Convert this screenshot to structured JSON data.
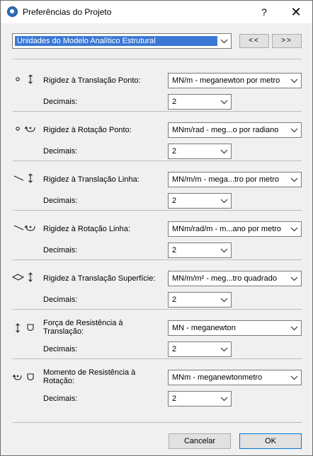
{
  "window": {
    "title": "Preferências do Projeto",
    "help": "?",
    "close": "✕"
  },
  "header": {
    "dropdown_value": "Unidades do Modelo Analítico Estrutural",
    "prev_label": "<<",
    "next_label": ">>"
  },
  "rows": [
    {
      "label": "Rigidez à Translação Ponto:",
      "unit": "MN/m - meganewton por metro",
      "decimals_label": "Decimais:",
      "decimals": "2"
    },
    {
      "label": "Rigidez à Rotação Ponto:",
      "unit": "MNm/rad - meg...o por radiano",
      "decimals_label": "Decimais:",
      "decimals": "2"
    },
    {
      "label": "Rigidez à Translação Linha:",
      "unit": "MN/m/m - mega...tro por metro",
      "decimals_label": "Decimais:",
      "decimals": "2"
    },
    {
      "label": "Rigidez à Rotação Linha:",
      "unit": "MNm/rad/m - m...ano por metro",
      "decimals_label": "Decimais:",
      "decimals": "2"
    },
    {
      "label": "Rigidez à Translação Superfície:",
      "unit": "MN/m/m² - meg...tro quadrado",
      "decimals_label": "Decimais:",
      "decimals": "2"
    },
    {
      "label_line1": "Força de Resistência à",
      "label_line2": "Translação:",
      "unit": "MN - meganewton",
      "decimals_label": "Decimais:",
      "decimals": "2"
    },
    {
      "label_line1": "Momento de Resistência à",
      "label_line2": "Rotação:",
      "unit": "MNm - meganewtonmetro",
      "decimals_label": "Decimais:",
      "decimals": "2"
    }
  ],
  "footer": {
    "cancel_label": "Cancelar",
    "ok_label": "OK"
  }
}
